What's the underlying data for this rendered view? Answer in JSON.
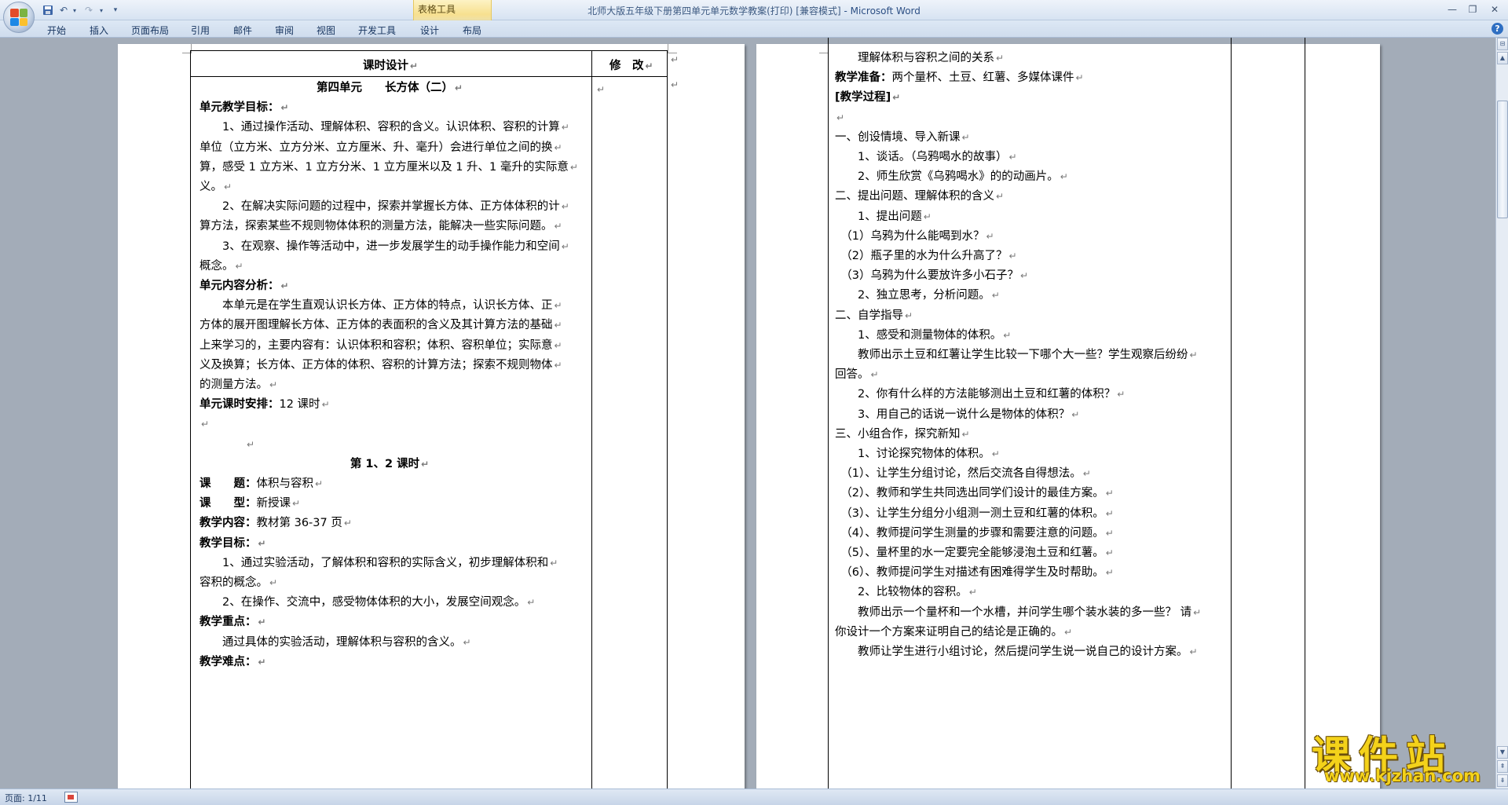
{
  "window": {
    "title": "北师大版五年级下册第四单元单元数学教案(打印) [兼容模式]",
    "app": " - Microsoft Word",
    "context_tab_group": "表格工具"
  },
  "ribbon_tabs": [
    "开始",
    "插入",
    "页面布局",
    "引用",
    "邮件",
    "审阅",
    "视图",
    "开发工具",
    "设计",
    "布局"
  ],
  "quick_access": [
    "save-icon",
    "undo-icon",
    "redo-icon",
    "customize-icon"
  ],
  "page1": {
    "header_left": "课时设计",
    "header_right": "修　改",
    "lines": [
      {
        "text": "第四单元　　长方体（二）",
        "bold": true,
        "center": true
      },
      {
        "text": "单元教学目标：",
        "bold": true
      },
      {
        "text": "　　1、通过操作活动、理解体积、容积的含义。认识体积、容积的计算"
      },
      {
        "text": "单位（立方米、立方分米、立方厘米、升、毫升）会进行单位之间的换"
      },
      {
        "text": "算，感受 1 立方米、1 立方分米、1 立方厘米以及 1 升、1 毫升的实际意"
      },
      {
        "text": "义。"
      },
      {
        "text": "　　2、在解决实际问题的过程中，探索并掌握长方体、正方体体积的计"
      },
      {
        "text": "算方法，探索某些不规则物体体积的测量方法，能解决一些实际问题。"
      },
      {
        "text": "　　3、在观察、操作等活动中，进一步发展学生的动手操作能力和空间"
      },
      {
        "text": "概念。"
      },
      {
        "text": "单元内容分析：",
        "bold": true
      },
      {
        "text": "　　本单元是在学生直观认识长方体、正方体的特点，认识长方体、正"
      },
      {
        "text": "方体的展开图理解长方体、正方体的表面积的含义及其计算方法的基础"
      },
      {
        "text": "上来学习的，主要内容有：认识体积和容积；体积、容积单位；实际意"
      },
      {
        "text": "义及换算；长方体、正方体的体积、容积的计算方法；探索不规则物体"
      },
      {
        "text": "的测量方法。"
      },
      {
        "text": "单元课时安排：12 课时",
        "bold_prefix": "单元课时安排："
      },
      {
        "text": ""
      },
      {
        "text": "　　　　"
      },
      {
        "text": "第 1、2 课时",
        "bold": true,
        "center": true
      },
      {
        "text": "课　　题：体积与容积",
        "bold_prefix": "课　　题："
      },
      {
        "text": "课　　型：新授课",
        "bold_prefix": "课　　型："
      },
      {
        "text": "教学内容：教材第 36-37 页",
        "bold_prefix": "教学内容："
      },
      {
        "text": "教学目标：",
        "bold": true
      },
      {
        "text": "　　1、通过实验活动，了解体积和容积的实际含义，初步理解体积和"
      },
      {
        "text": "容积的概念。"
      },
      {
        "text": "　　2、在操作、交流中，感受物体体积的大小，发展空间观念。"
      },
      {
        "text": "教学重点：",
        "bold": true
      },
      {
        "text": "　　通过具体的实验活动，理解体积与容积的含义。"
      },
      {
        "text": "教学难点：",
        "bold": true
      }
    ]
  },
  "page2": {
    "lines": [
      {
        "text": "　　理解体积与容积之间的关系"
      },
      {
        "text": "教学准备：两个量杯、土豆、红薯、多媒体课件",
        "bold_prefix": "教学准备："
      },
      {
        "text": "[教学过程]",
        "bold": true
      },
      {
        "text": ""
      },
      {
        "text": "一、创设情境、导入新课"
      },
      {
        "text": "　　1、谈话。（乌鸦喝水的故事）"
      },
      {
        "text": "　　2、师生欣赏《乌鸦喝水》的的动画片。"
      },
      {
        "text": "二、提出问题、理解体积的含义"
      },
      {
        "text": "　　1、提出问题"
      },
      {
        "text": "　（1）乌鸦为什么能喝到水？"
      },
      {
        "text": "　（2）瓶子里的水为什么升高了？"
      },
      {
        "text": "　（3）乌鸦为什么要放许多小石子？"
      },
      {
        "text": "　　2、独立思考，分析问题。"
      },
      {
        "text": "二、自学指导"
      },
      {
        "text": "　　1、感受和测量物体的体积。"
      },
      {
        "text": "　　教师出示土豆和红薯让学生比较一下哪个大一些？学生观察后纷纷"
      },
      {
        "text": "回答。"
      },
      {
        "text": "　　2、你有什么样的方法能够测出土豆和红薯的体积？"
      },
      {
        "text": "　　3、用自己的话说一说什么是物体的体积？"
      },
      {
        "text": "三、小组合作，探究新知"
      },
      {
        "text": "　　1、讨论探究物体的体积。"
      },
      {
        "text": "　（1）、让学生分组讨论，然后交流各自得想法。"
      },
      {
        "text": "　（2）、教师和学生共同选出同学们设计的最佳方案。"
      },
      {
        "text": "　（3）、让学生分组分小组测一测土豆和红薯的体积。"
      },
      {
        "text": "　（4）、教师提问学生测量的步骤和需要注意的问题。"
      },
      {
        "text": "　（5）、量杯里的水一定要完全能够浸泡土豆和红薯。"
      },
      {
        "text": "　（6）、教师提问学生对描述有困难得学生及时帮助。"
      },
      {
        "text": "　　2、比较物体的容积。"
      },
      {
        "text": "　　教师出示一个量杯和一个水槽，并问学生哪个装水装的多一些？ 请"
      },
      {
        "text": "你设计一个方案来证明自己的结论是正确的。"
      },
      {
        "text": "　　教师让学生进行小组讨论，然后提问学生说一说自己的设计方案。"
      }
    ]
  },
  "status": {
    "page_indicator": "页面: 1/11"
  },
  "watermark": {
    "title": "课件站",
    "url": "www.kjzhan.com"
  },
  "colors": {
    "accent": "#2c4f84",
    "ribbon": "#cfdced",
    "workspace": "#a3acb8",
    "watermark": "#f4d21a"
  }
}
